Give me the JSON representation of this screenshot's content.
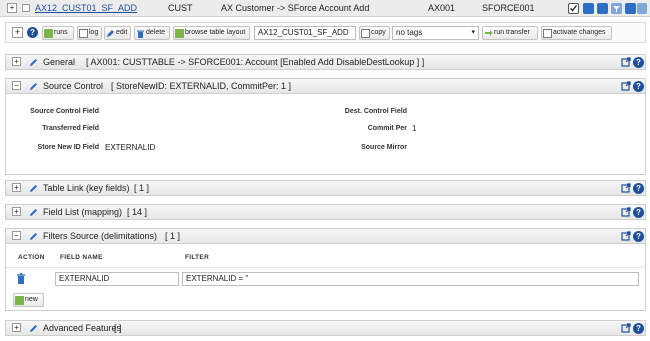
{
  "topbar": {
    "record_name": "AX12_CUST01_SF_ADD",
    "source_object": "CUST",
    "description": "AX Customer -> SForce Account Add",
    "source_system": "AX001",
    "target_system": "SFORCE001"
  },
  "toolbar": {
    "runs_label": "runs",
    "log_label": "log",
    "edit_label": "edit",
    "delete_label": "delete",
    "browse_label": "browse table layout",
    "name_value": "AX12_CUST01_SF_ADD",
    "copy_label": "copy",
    "tags_value": "no tags",
    "run_transfer_label": "run transfer",
    "activate_label": "activate changes"
  },
  "panels": {
    "general": {
      "title": "General",
      "detail": "[ AX001: CUSTTABLE -> SFORCE001: Account [Enabled Add DisableDestLookup ] ]"
    },
    "source_control": {
      "title": "Source Control",
      "detail": "[ StoreNewID: EXTERNALID, CommitPer: 1 ]"
    },
    "table_link": {
      "title": "Table Link (key fields)",
      "detail": "[ 1 ]"
    },
    "field_list": {
      "title": "Field List (mapping)",
      "detail": "[ 14 ]"
    },
    "filters_source": {
      "title": "Filters Source (delimitations)",
      "detail": "[ 1 ]"
    },
    "advanced": {
      "title": "Advanced Features",
      "detail": "[ ]"
    }
  },
  "source_control": {
    "source_control_field_label": "Source Control Field",
    "source_control_field_value": "",
    "transferred_field_label": "Transferred Field",
    "transferred_field_value": "",
    "store_new_id_label": "Store New ID Field",
    "store_new_id_value": "EXTERNALID",
    "dest_control_field_label": "Dest. Control Field",
    "dest_control_field_value": "",
    "commit_per_label": "Commit Per",
    "commit_per_value": "1",
    "source_mirror_label": "Source Mirror",
    "source_mirror_value": ""
  },
  "filters": {
    "columns": [
      "ACTION",
      "FIELD NAME",
      "FILTER"
    ],
    "rows": [
      {
        "field_name": "EXTERNALID",
        "filter": "EXTERNALID = ''"
      }
    ],
    "new_label": "new"
  },
  "colors": {
    "accent_blue": "#1d4f9a",
    "link_blue": "#1f4fa0",
    "panel_header": "#ececec"
  }
}
